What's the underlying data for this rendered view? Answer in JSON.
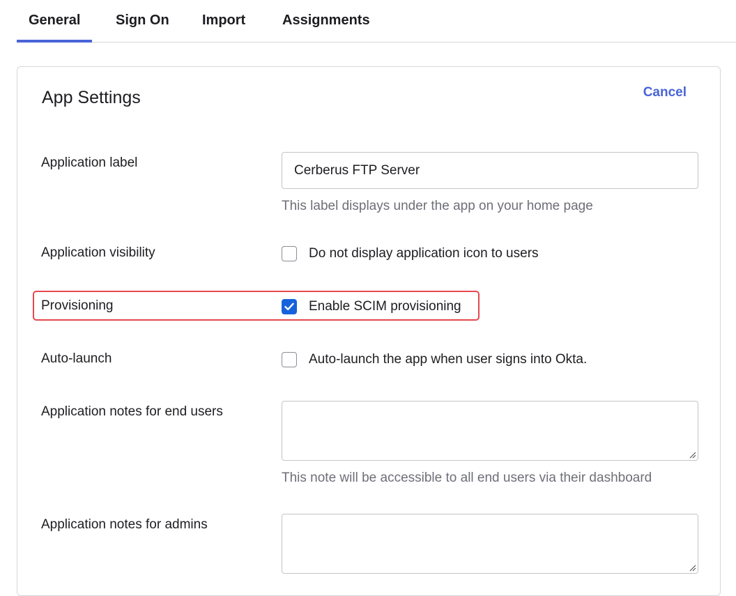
{
  "tabs": [
    {
      "label": "General",
      "active": true
    },
    {
      "label": "Sign On",
      "active": false
    },
    {
      "label": "Import",
      "active": false
    },
    {
      "label": "Assignments",
      "active": false
    }
  ],
  "card": {
    "title": "App Settings",
    "cancel_label": "Cancel"
  },
  "fields": {
    "app_label": {
      "label": "Application label",
      "value": "Cerberus FTP Server",
      "hint": "This label displays under the app on your home page"
    },
    "visibility": {
      "label": "Application visibility",
      "option": "Do not display application icon to users",
      "checked": false
    },
    "provisioning": {
      "label": "Provisioning",
      "option": "Enable SCIM provisioning",
      "checked": true
    },
    "auto_launch": {
      "label": "Auto-launch",
      "option": "Auto-launch the app when user signs into Okta.",
      "checked": false
    },
    "notes_end_users": {
      "label": "Application notes for end users",
      "value": "",
      "hint": "This note will be accessible to all end users via their dashboard"
    },
    "notes_admins": {
      "label": "Application notes for admins",
      "value": ""
    }
  },
  "colors": {
    "accent": "#4a64d8",
    "checkbox_checked": "#1662dd",
    "highlight_border": "#e5484d"
  },
  "icons": {
    "check": "checkmark-icon",
    "resize": "resize-grip-icon"
  }
}
